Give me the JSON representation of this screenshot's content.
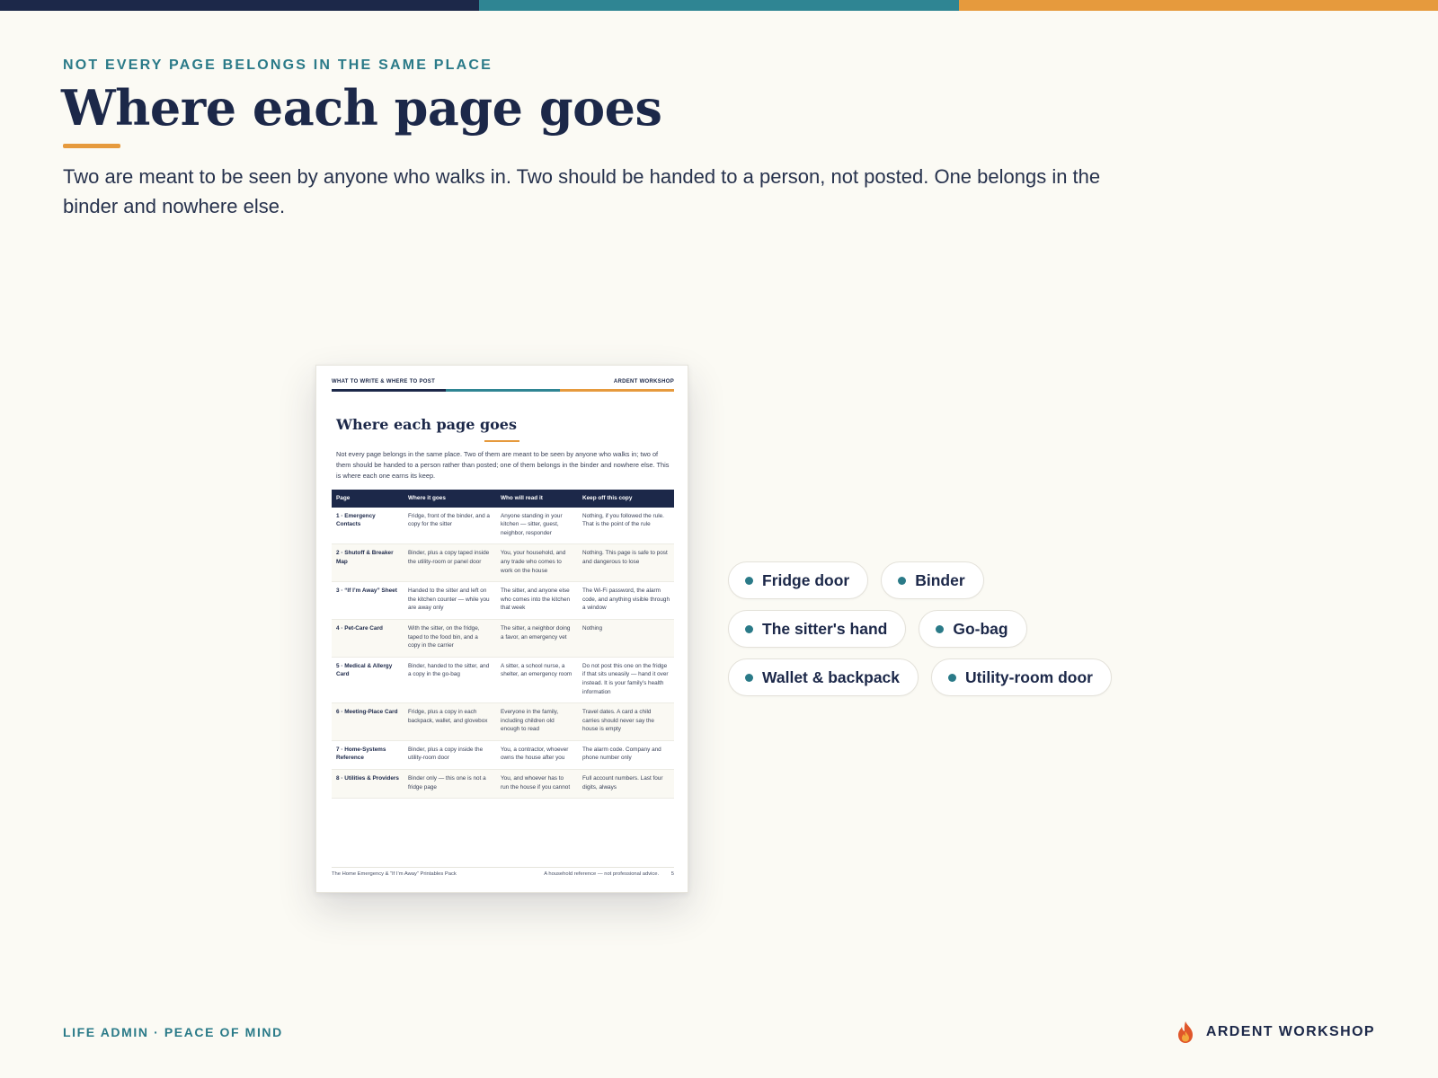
{
  "colors": {
    "navy": "#1c2849",
    "teal": "#2f8593",
    "orange": "#e69a3d",
    "background": "#fbfaf4"
  },
  "header": {
    "eyebrow": "NOT EVERY PAGE BELONGS IN THE SAME PLACE",
    "title": "Where each page goes",
    "lede": "Two are meant to be seen by anyone who walks in. Two should be handed to a person, not posted. One belongs in the binder and nowhere else."
  },
  "document": {
    "header_left": "WHAT TO WRITE & WHERE TO POST",
    "header_right": "ARDENT WORKSHOP",
    "title": "Where each page goes",
    "intro": "Not every page belongs in the same place. Two of them are meant to be seen by anyone who walks in; two of them should be handed to a person rather than posted; one of them belongs in the binder and nowhere else. This is where each one earns its keep.",
    "columns": [
      "Page",
      "Where it goes",
      "Who will read it",
      "Keep off this copy"
    ],
    "rows": [
      [
        "1 · Emergency Contacts",
        "Fridge, front of the binder, and a copy for the sitter",
        "Anyone standing in your kitchen — sitter, guest, neighbor, responder",
        "Nothing, if you followed the rule. That is the point of the rule"
      ],
      [
        "2 · Shutoff & Breaker Map",
        "Binder, plus a copy taped inside the utility-room or panel door",
        "You, your household, and any trade who comes to work on the house",
        "Nothing. This page is safe to post and dangerous to lose"
      ],
      [
        "3 · “If I’m Away” Sheet",
        "Handed to the sitter and left on the kitchen counter — while you are away only",
        "The sitter, and anyone else who comes into the kitchen that week",
        "The Wi-Fi password, the alarm code, and anything visible through a window"
      ],
      [
        "4 · Pet-Care Card",
        "With the sitter, on the fridge, taped to the food bin, and a copy in the carrier",
        "The sitter, a neighbor doing a favor, an emergency vet",
        "Nothing"
      ],
      [
        "5 · Medical & Allergy Card",
        "Binder, handed to the sitter, and a copy in the go-bag",
        "A sitter, a school nurse, a shelter, an emergency room",
        "Do not post this one on the fridge if that sits uneasily — hand it over instead. It is your family’s health information"
      ],
      [
        "6 · Meeting-Place Card",
        "Fridge, plus a copy in each backpack, wallet, and glovebox",
        "Everyone in the family, including children old enough to read",
        "Travel dates. A card a child carries should never say the house is empty"
      ],
      [
        "7 · Home-Systems Reference",
        "Binder, plus a copy inside the utility-room door",
        "You, a contractor, whoever owns the house after you",
        "The alarm code. Company and phone number only"
      ],
      [
        "8 · Utilities & Providers",
        "Binder only — this one is not a fridge page",
        "You, and whoever has to run the house if you cannot",
        "Full account numbers. Last four digits, always"
      ]
    ],
    "footer_left": "The Home Emergency & “If I’m Away” Printables Pack",
    "footer_right": "A household reference — not professional advice.",
    "page_number": "5"
  },
  "chips": [
    [
      "Fridge door",
      "Binder"
    ],
    [
      "The sitter's hand",
      "Go-bag"
    ],
    [
      "Wallet & backpack",
      "Utility-room door"
    ]
  ],
  "footer": {
    "left": "LIFE ADMIN · PEACE OF MIND",
    "brand": "ARDENT WORKSHOP",
    "brand_icon": "flame-logo-icon"
  }
}
